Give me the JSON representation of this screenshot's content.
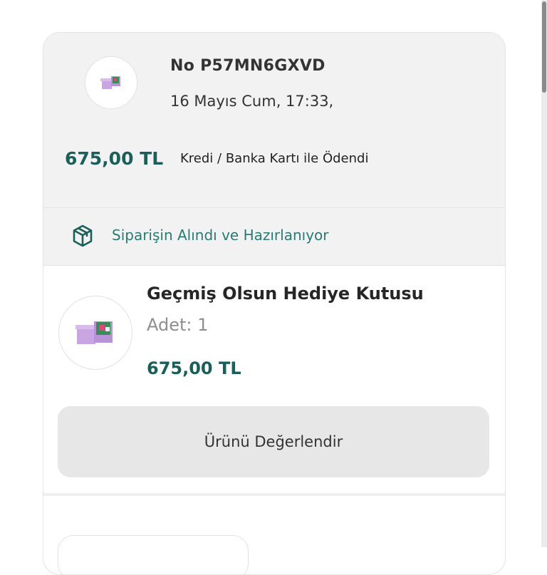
{
  "order": {
    "number": "No P57MN6GXVD",
    "date": "16 Mayıs Cum, 17:33,",
    "total": "675,00 TL",
    "payment": "Kredi / Banka Kartı ile Ödendi",
    "status": "Siparişin Alındı ve Hazırlanıyor"
  },
  "product": {
    "name": "Geçmiş Olsun Hediye Kutusu",
    "quantity": "Adet: 1",
    "price": "675,00 TL",
    "review_button": "Ürünü Değerlendir"
  },
  "icons": {
    "status": "package-icon",
    "product_image": "gift-box-image"
  },
  "colors": {
    "accent": "#1b5f5a",
    "status": "#2a7a74",
    "box_purple": "#c9a6e2"
  }
}
